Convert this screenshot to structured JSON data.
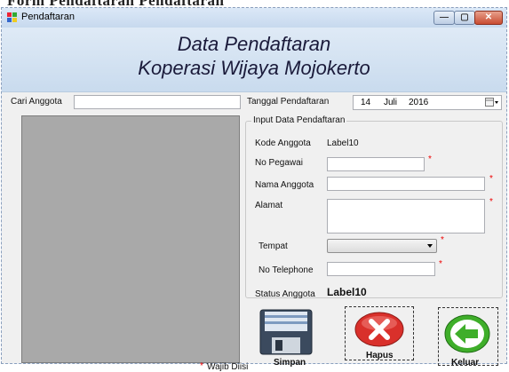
{
  "page_caption": "Form Pendaftaran Pendaftaran",
  "window": {
    "title": "Pendaftaran",
    "min_glyph": "—",
    "max_glyph": "▢",
    "close_glyph": "✕"
  },
  "header": {
    "title_line1": "Data Pendaftaran",
    "title_line2": "Koperasi Wijaya Mojokerto"
  },
  "search": {
    "label": "Cari Anggota",
    "value": ""
  },
  "date": {
    "label": "Tanggal Pendaftaran",
    "day": "14",
    "month": "Juli",
    "year": "2016"
  },
  "group": {
    "title": "Input Data Pendaftaran",
    "kode_label": "Kode Anggota",
    "kode_value": "Label10",
    "no_pegawai_label": "No Pegawai",
    "nama_label": "Nama Anggota",
    "alamat_label": "Alamat",
    "tempat_label": "Tempat",
    "telephone_label": "No Telephone",
    "status_label": "Status Anggota",
    "status_value": "Label10"
  },
  "required_mark": "*",
  "footer_note": "Wajib Diisi",
  "buttons": {
    "simpan": "Simpan",
    "hapus": "Hapus",
    "keluar": "Keluar"
  },
  "colors": {
    "accent_red": "#e00000",
    "button_green": "#3fae2a",
    "button_red": "#d9302b"
  }
}
